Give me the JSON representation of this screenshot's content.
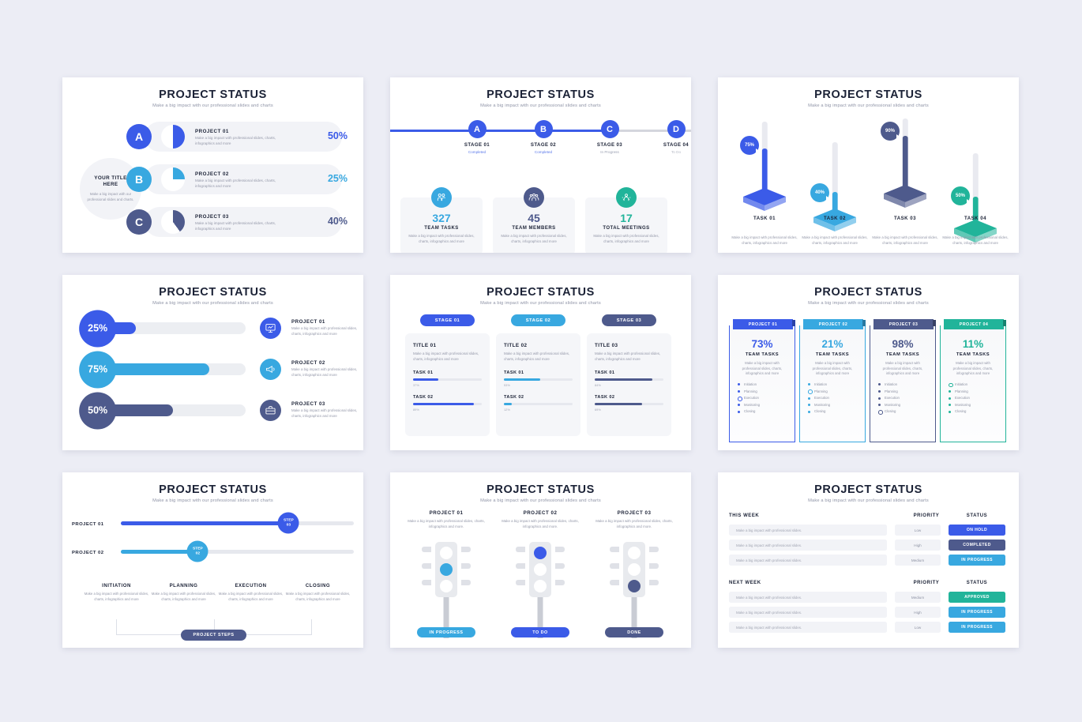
{
  "common": {
    "title": "PROJECT STATUS",
    "subtitle": "Make a big impact with our professional slides and charts",
    "desc_long": "Make a big impact with professional slides, charts, infographics and more",
    "desc_short": "Make a big impact with professional slides, charts, infographics and more."
  },
  "colors": {
    "royal": "#3b5be8",
    "sky": "#38a8e0",
    "slate": "#4e5a8c",
    "teal": "#21b49a",
    "track": "#eceef2",
    "bg": "#ecedf5"
  },
  "card1": {
    "side": {
      "heading": "YOUR TITLE HERE",
      "desc": "Make a big impact with our professional slides and charts."
    },
    "rows": [
      {
        "badge": "A",
        "name": "PROJECT 01",
        "desc": "Make a big impact with professional slides, charts, infographics and more",
        "pct": "50%",
        "value": 50,
        "color": "#3b5be8"
      },
      {
        "badge": "B",
        "name": "PROJECT 02",
        "desc": "Make a big impact with professional slides, charts, infographics and more",
        "pct": "25%",
        "value": 25,
        "color": "#38a8e0"
      },
      {
        "badge": "C",
        "name": "PROJECT 03",
        "desc": "Make a big impact with professional slides, charts, infographics and more",
        "pct": "40%",
        "value": 40,
        "color": "#4e5a8c"
      }
    ]
  },
  "card2": {
    "stages": [
      {
        "letter": "A",
        "name": "STAGE 01",
        "status": "Completed",
        "color": "#3b5be8",
        "status_color": "#5a78ea"
      },
      {
        "letter": "B",
        "name": "STAGE 02",
        "status": "Completed",
        "color": "#3b5be8",
        "status_color": "#5a78ea"
      },
      {
        "letter": "C",
        "name": "STAGE 03",
        "status": "In Progress",
        "color": "#3b5be8",
        "status_color": "#9aa0b2"
      },
      {
        "letter": "D",
        "name": "STAGE 04",
        "status": "To Do",
        "color": "#3b5be8",
        "status_color": "#b4b8c5"
      }
    ],
    "stats": [
      {
        "num": "327",
        "label": "TEAM TASKS",
        "desc": "Make a big impact with professional slides, charts, infographics and more",
        "color": "#38a8e0",
        "icon": "people-icon"
      },
      {
        "num": "45",
        "label": "TEAM MEMBERS",
        "desc": "Make a big impact with professional slides, charts, infographics and more",
        "color": "#4e5a8c",
        "icon": "group-icon"
      },
      {
        "num": "17",
        "label": "TOTAL MEETINGS",
        "desc": "Make a big impact with professional slides, charts, infographics and more",
        "color": "#21b49a",
        "icon": "meeting-icon"
      }
    ]
  },
  "card3": {
    "tasks": [
      {
        "pct": "75%",
        "value": 75,
        "name": "TASK 01",
        "desc": "Make a big impact with professional slides, charts, infographics and more",
        "color": "#3b5be8"
      },
      {
        "pct": "40%",
        "value": 40,
        "name": "TASK 02",
        "desc": "Make a big impact with professional slides, charts, infographics and more",
        "color": "#38a8e0"
      },
      {
        "pct": "90%",
        "value": 90,
        "name": "TASK 03",
        "desc": "Make a big impact with professional slides, charts, infographics and more",
        "color": "#4e5a8c"
      },
      {
        "pct": "50%",
        "value": 50,
        "name": "TASK 04",
        "desc": "Make a big impact with professional slides, charts, infographics and more",
        "color": "#21b49a"
      }
    ]
  },
  "card4": {
    "rows": [
      {
        "pct": "25%",
        "value": 25,
        "name": "PROJECT 01",
        "desc": "Make a big impact with professional slides, charts, infographics and more",
        "color": "#3b5be8",
        "icon": "presentation-icon"
      },
      {
        "pct": "75%",
        "value": 75,
        "name": "PROJECT 02",
        "desc": "Make a big impact with professional slides, charts, infographics and more",
        "color": "#38a8e0",
        "icon": "megaphone-icon"
      },
      {
        "pct": "50%",
        "value": 50,
        "name": "PROJECT 03",
        "desc": "Make a big impact with professional slides, charts, infographics and more",
        "color": "#4e5a8c",
        "icon": "briefcase-icon"
      }
    ]
  },
  "card5": {
    "columns": [
      {
        "stage": "STAGE 01",
        "color": "#3b5be8",
        "title": "TITLE 01",
        "desc": "Make a big impact with professional slides, charts, infographics and more",
        "tasks": [
          {
            "label": "TASK  01",
            "pct": "37%",
            "value": 37
          },
          {
            "label": "TASK  02",
            "pct": "89%",
            "value": 89
          }
        ]
      },
      {
        "stage": "STAGE 02",
        "color": "#38a8e0",
        "title": "TITLE 02",
        "desc": "Make a big impact with professional slides, charts, infographics and more",
        "tasks": [
          {
            "label": "TASK  01",
            "pct": "53%",
            "value": 53
          },
          {
            "label": "TASK  02",
            "pct": "12%",
            "value": 12
          }
        ]
      },
      {
        "stage": "STAGE 03",
        "color": "#4e5a8c",
        "title": "TITLE 03",
        "desc": "Make a big impact with professional slides, charts, infographics and more",
        "tasks": [
          {
            "label": "TASK  01",
            "pct": "84%",
            "value": 84
          },
          {
            "label": "TASK  02",
            "pct": "69%",
            "value": 69
          }
        ]
      }
    ]
  },
  "card6": {
    "panels": [
      {
        "ribbon": "PROJECT 01",
        "pct": "73%",
        "label": "TEAM TASKS",
        "desc": "Make a big impact with professional slides, charts, infographics and more",
        "color": "#3b5be8",
        "steps": [
          "Initiation",
          "Planning",
          "Execution",
          "Monitoring",
          "Closing"
        ],
        "active": 2
      },
      {
        "ribbon": "PROJECT 02",
        "pct": "21%",
        "label": "TEAM TASKS",
        "desc": "Make a big impact with professional slides, charts, infographics and more",
        "color": "#38a8e0",
        "steps": [
          "Initiation",
          "Planning",
          "Execution",
          "Monitoring",
          "Closing"
        ],
        "active": 1
      },
      {
        "ribbon": "PROJECT 03",
        "pct": "98%",
        "label": "TEAM TASKS",
        "desc": "Make a big impact with professional slides, charts, infographics and more",
        "color": "#4e5a8c",
        "steps": [
          "Initiation",
          "Planning",
          "Execution",
          "Monitoring",
          "Closing"
        ],
        "active": 4
      },
      {
        "ribbon": "PROJECT 04",
        "pct": "11%",
        "label": "TEAM TASKS",
        "desc": "Make a big impact with professional slides, charts, infographics and more",
        "color": "#21b49a",
        "steps": [
          "Initiation",
          "Planning",
          "Execution",
          "Monitoring",
          "Closing"
        ],
        "active": 0
      }
    ]
  },
  "card7": {
    "sliders": [
      {
        "label": "PROJECT 01",
        "step_word": "STEP",
        "step_num": "03",
        "value": 72,
        "color": "#3b5be8"
      },
      {
        "label": "PROJECT 02",
        "step_word": "STEP",
        "step_num": "02",
        "value": 33,
        "color": "#38a8e0"
      }
    ],
    "steps": [
      {
        "name": "INITIATION",
        "desc": "Make a big impact with professional slides, charts, infographics and more"
      },
      {
        "name": "PLANNING",
        "desc": "Make a big impact with professional slides, charts, infographics and more"
      },
      {
        "name": "EXECUTION",
        "desc": "Make a big impact with professional slides, charts, infographics and more"
      },
      {
        "name": "CLOSING",
        "desc": "Make a big impact with professional slides, charts, infographics and more"
      }
    ],
    "footer_pill": "PROJECT STEPS"
  },
  "card8": {
    "lights": [
      {
        "name": "PROJECT 01",
        "desc": "Make a big impact with professional slides, charts, infographics and more.",
        "lit": 1,
        "badge": "IN PROGRESS",
        "color": "#38a8e0"
      },
      {
        "name": "PROJECT 02",
        "desc": "Make a big impact with professional slides, charts, infographics and more.",
        "lit": 0,
        "badge": "TO DO",
        "color": "#3b5be8"
      },
      {
        "name": "PROJECT 03",
        "desc": "Make a big impact with professional slides, charts, infographics and more.",
        "lit": 2,
        "badge": "DONE",
        "color": "#4e5a8c"
      }
    ]
  },
  "card9": {
    "sections": [
      {
        "title": "THIS WEEK",
        "col_priority": "PRIORITY",
        "col_status": "STATUS",
        "rows": [
          {
            "task": "Make a big impact with professional slides.",
            "priority": "Low",
            "status": "ON HOLD",
            "color": "#3b5be8"
          },
          {
            "task": "Make a big impact with professional slides.",
            "priority": "High",
            "status": "COMPLETED",
            "color": "#4e5a8c"
          },
          {
            "task": "Make a big impact with professional slides.",
            "priority": "Medium",
            "status": "IN PROGRESS",
            "color": "#38a8e0"
          }
        ]
      },
      {
        "title": "NEXT WEEK",
        "col_priority": "PRIORITY",
        "col_status": "STATUS",
        "rows": [
          {
            "task": "Make a big impact with professional slides.",
            "priority": "Medium",
            "status": "APPROVED",
            "color": "#21b49a"
          },
          {
            "task": "Make a big impact with professional slides.",
            "priority": "High",
            "status": "IN PROGRESS",
            "color": "#38a8e0"
          },
          {
            "task": "Make a big impact with professional slides.",
            "priority": "Low",
            "status": "IN PROGRESS",
            "color": "#38a8e0"
          }
        ]
      }
    ]
  }
}
